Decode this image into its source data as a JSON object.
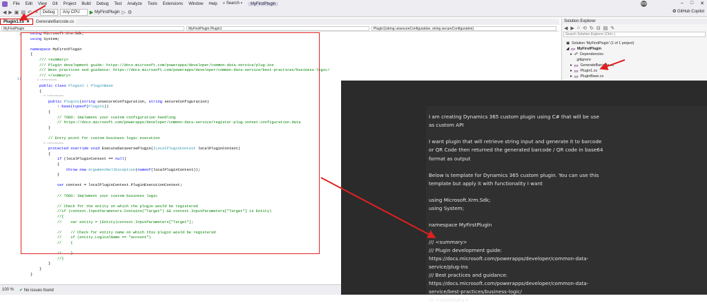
{
  "menubar": {
    "items": [
      "File",
      "Edit",
      "View",
      "Git",
      "Project",
      "Build",
      "Debug",
      "Test",
      "Analyze",
      "Tools",
      "Extensions",
      "Window",
      "Help"
    ],
    "search": "Search",
    "project": "MyFirstPlugin",
    "avatar": "RN"
  },
  "toolbar": {
    "config": "Debug",
    "platform": "Any CPU",
    "run_label": "MyFirstPlugin",
    "copilot": "GitHub Copilot"
  },
  "tabs": [
    {
      "label": "Plugin1.cs",
      "active": true
    },
    {
      "label": "GenerateBarcode.cs",
      "active": false
    }
  ],
  "navbar": {
    "project": "MyFirstPlugin",
    "class": "MyFirstPlugin.Plugin1",
    "member": "Plugin1(string unsecureConfiguration, string secureConfiguration)"
  },
  "editor": {
    "line_numbers": [
      "2",
      "",
      "",
      "",
      "",
      "",
      "",
      "",
      "",
      "",
      "",
      "17",
      "",
      "",
      "",
      "",
      "",
      "",
      "",
      "",
      "",
      "",
      "",
      "",
      "",
      "",
      "",
      "",
      "",
      "",
      "",
      "",
      "",
      "",
      "",
      ""
    ],
    "lines": [
      "using Microsoft.Xrm.Sdk;",
      "using System;",
      "",
      "namespace MyFirstPlugin",
      "{",
      "    /// <summary>",
      "    /// Plugin development guide: https://docs.microsoft.com/powerapps/developer/common-data-service/plug-ins",
      "    /// Best practices and guidance: https://docs.microsoft.com/powerapps/developer/common-data-service/best-practices/business-logic/",
      "    /// </summary>",
      "    2 references",
      "    public class Plugin1 : PluginBase",
      "    {",
      "        0 references",
      "        public Plugin1(string unsecureConfiguration, string secureConfiguration)",
      "            : base(typeof(Plugin1))",
      "        {",
      "            // TODO: Implement your custom configuration handling",
      "            // https://docs.microsoft.com/powerapps/developer/common-data-service/register-plug-in#set-configuration-data",
      "        }",
      "",
      "        // Entry point for custom business logic execution",
      "        0 references",
      "        protected override void ExecuteDataversePlugin(ILocalPluginContext localPluginContext)",
      "        {",
      "            if (localPluginContext == null)",
      "            {",
      "                throw new ArgumentNullException(nameof(localPluginContext));",
      "            }",
      "",
      "            var context = localPluginContext.PluginExecutionContext;",
      "",
      "            // TODO: Implement your custom business logic",
      "",
      "            // Check for the entity on which the plugin would be registered",
      "            //if (context.InputParameters.Contains(\"Target\") && context.InputParameters[\"Target\"] is Entity)",
      "            //{",
      "            //    var entity = (Entity)context.InputParameters[\"Target\"];",
      "",
      "            //    // Check for entity name on which this plugin would be registered",
      "            //    if (entity.LogicalName == \"account\")",
      "            //    {",
      "",
      "            //    }",
      "            //}",
      "        }",
      "    }",
      "}"
    ]
  },
  "status": {
    "zoom": "100 %",
    "issues": "No issues found"
  },
  "solution_explorer": {
    "title": "Solution Explorer",
    "search_placeholder": "Search Solution Explorer (Ctrl+;)",
    "items": [
      "Solution 'MyFirstPlugin' (1 of 1 project)",
      "MyFirstPlugin",
      "Dependencies",
      ".gitignore",
      "GenerateBarcode.cs",
      "Plugin1.cs",
      "PluginBase.cs"
    ]
  },
  "chat": {
    "lines": [
      "I am creating Dynamics 365 custom plugin using C# that will be use",
      "as custom API",
      "",
      "I want plugin that will retrieve string input and generate it to barcode",
      "or QR Code then returned the generated barcode / QR code in base64",
      "format as output",
      "",
      "Below is template for Dynamics 365 custom plugin. You can use this",
      "template but apply it with functionality I want",
      "",
      "using Microsoft.Xrm.Sdk;",
      "using System;",
      "",
      "namespace MyFirstPlugin",
      "{",
      "    /// <summary>",
      "    /// Plugin development guide:",
      "https://docs.microsoft.com/powerapps/developer/common-data-",
      "service/plug-ins",
      "    /// Best practices and guidance:",
      "https://docs.microsoft.com/powerapps/developer/common-data-",
      "service/best-practices/business-logic/",
      "    /// </summary>"
    ]
  },
  "colors": {
    "annotation_red": "#e02020",
    "chat_bg": "#2b2b2b",
    "chrome_bg": "#eeeef2"
  }
}
